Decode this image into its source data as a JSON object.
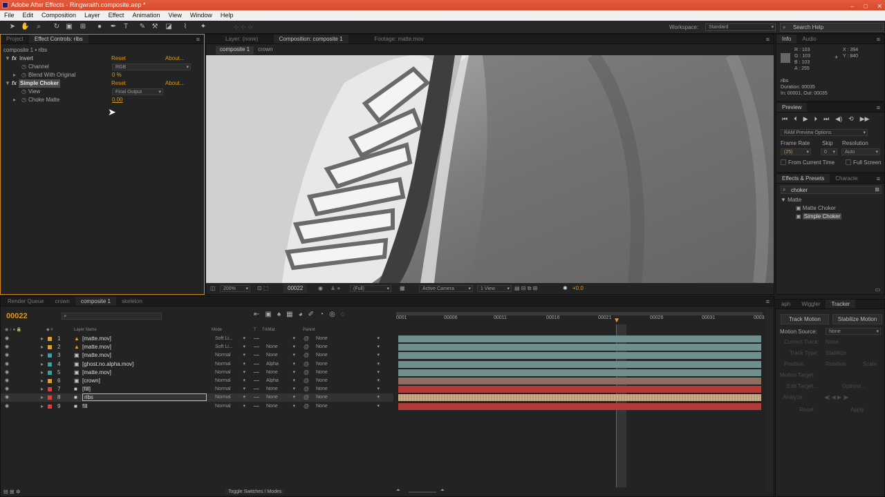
{
  "window": {
    "title": "Adobe After Effects - Ringwraith.composite.aep *",
    "controls": [
      "–",
      "□",
      "✕"
    ]
  },
  "menu": [
    "File",
    "Edit",
    "Composition",
    "Layer",
    "Effect",
    "Animation",
    "View",
    "Window",
    "Help"
  ],
  "workspace": {
    "label": "Workspace:",
    "value": "Standard"
  },
  "search_help": {
    "placeholder": "Search Help"
  },
  "project_tabs": {
    "project": "Project",
    "effect_controls": "Effect Controls: ribs"
  },
  "effect_controls": {
    "breadcrumb": "composite 1 • ribs",
    "effects": [
      {
        "name": "Invert",
        "reset": "Reset",
        "about": "About...",
        "props": [
          {
            "name": "Channel",
            "value": "RGB"
          },
          {
            "name": "Blend With Original",
            "value": "0 %"
          }
        ]
      },
      {
        "name": "Simple Choker",
        "reset": "Reset",
        "about": "About...",
        "props": [
          {
            "name": "View",
            "value": "Final Output"
          },
          {
            "name": "Choke Matte",
            "value": "0.00"
          }
        ]
      }
    ]
  },
  "viewer_tabs": {
    "layer": "Layer: (none)",
    "composition": "Composition: composite 1",
    "footage": "Footage: matte.mov"
  },
  "viewer_breadcrumbs": [
    "composite 1",
    "crown"
  ],
  "viewer_footer": {
    "zoom": "200%",
    "timecode": "00022",
    "resolution": "(Full)",
    "camera": "Active Camera",
    "views": "1 View",
    "exposure": "+0.0"
  },
  "info": {
    "tabs": [
      "Info",
      "Audio"
    ],
    "rgba": [
      "R : 103",
      "G : 103",
      "B : 103",
      "A : 255"
    ],
    "xy": [
      "X : 394",
      "Y : 840"
    ],
    "layer_name": "ribs",
    "duration": "Duration: 00035",
    "inout": "In: 00001, Out: 00035"
  },
  "preview": {
    "tab": "Preview",
    "ram_options": "RAM Preview Options",
    "frame_rate_label": "Frame Rate",
    "skip_label": "Skip",
    "resolution_label": "Resolution",
    "frame_rate": "(25)",
    "skip": "0",
    "resolution": "Auto",
    "from_current": "From Current Time",
    "full_screen": "Full Screen"
  },
  "effects_presets": {
    "tabs": [
      "Effects & Presets",
      "Characte"
    ],
    "search": "choker",
    "category": "Matte",
    "items": [
      "Matte Choker",
      "Simple Choker"
    ]
  },
  "timeline_tabs": [
    "Render Queue",
    "crown",
    "composite 1",
    "skeleton"
  ],
  "timeline": {
    "timecode": "00022",
    "headers": {
      "layer_name": "Layer Name",
      "mode": "Mode",
      "t": "T",
      "trkmat": "TrkMat",
      "parent": "Parent"
    },
    "ruler": [
      "0001",
      "00006",
      "00011",
      "00016",
      "00021",
      "00026",
      "00031",
      "0003"
    ],
    "layers": [
      {
        "num": "1",
        "name": "[matte.mov]",
        "mode": "Soft Li...",
        "trkmat": "",
        "parent": "None"
      },
      {
        "num": "2",
        "name": "[matte.mov]",
        "mode": "Soft Li...",
        "trkmat": "None",
        "parent": "None"
      },
      {
        "num": "3",
        "name": "[matte.mov]",
        "mode": "Normal",
        "trkmat": "None",
        "parent": "None"
      },
      {
        "num": "4",
        "name": "[ghost.no.alpha.mov]",
        "mode": "Normal",
        "trkmat": "Alpha",
        "parent": "None"
      },
      {
        "num": "5",
        "name": "[matte.mov]",
        "mode": "Normal",
        "trkmat": "None",
        "parent": "None"
      },
      {
        "num": "6",
        "name": "[crown]",
        "mode": "Normal",
        "trkmat": "Alpha",
        "parent": "None"
      },
      {
        "num": "7",
        "name": "[fill]",
        "mode": "Normal",
        "trkmat": "None",
        "parent": "None"
      },
      {
        "num": "8",
        "name": "ribs",
        "mode": "Normal",
        "trkmat": "None",
        "parent": "None"
      },
      {
        "num": "9",
        "name": "fill",
        "mode": "Normal",
        "trkmat": "None",
        "parent": "None"
      }
    ],
    "footer": "Toggle Switches / Modes"
  },
  "tracker": {
    "tabs": [
      "aph",
      "Wiggler",
      "Tracker"
    ],
    "track_motion": "Track Motion",
    "stabilize_motion": "Stabilize Motion",
    "motion_source_label": "Motion Source:",
    "motion_source": "None",
    "current_track": "Current Track:",
    "current_track_val": "None",
    "track_type": "Track Type:",
    "track_type_val": "Stabilize",
    "position": "Position",
    "rotation": "Rotation",
    "scale": "Scale",
    "motion_target": "Motion Target:",
    "edit_target": "Edit Target...",
    "options": "Options...",
    "analyze": "Analyze:",
    "reset": "Reset",
    "apply": "Apply"
  },
  "colors": {
    "accent_orange": "#d99a1a",
    "title_red": "#dd5233",
    "teal_bar": "#6f8e8e",
    "red_bar": "#b43c38",
    "tan_bar": "#c8ae88"
  }
}
